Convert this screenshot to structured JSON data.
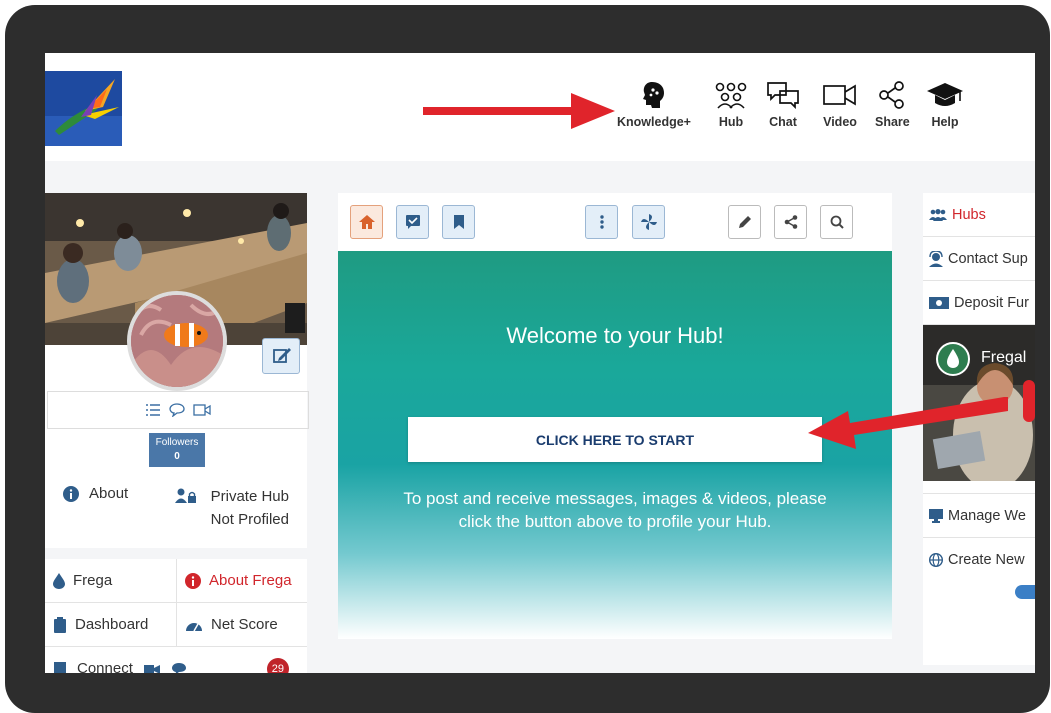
{
  "nav": {
    "items": [
      {
        "label": "Knowledge+",
        "icon": "brain-icon"
      },
      {
        "label": "Hub",
        "icon": "users-icon"
      },
      {
        "label": "Chat",
        "icon": "chat-icon"
      },
      {
        "label": "Video",
        "icon": "video-icon"
      },
      {
        "label": "Share",
        "icon": "share-icon"
      },
      {
        "label": "Help",
        "icon": "graduation-cap-icon"
      }
    ]
  },
  "profile": {
    "followers_label": "Followers",
    "followers_count": "0",
    "about_label": "About",
    "hub_type": "Private Hub",
    "hub_status": "Not Profiled"
  },
  "left_menu": [
    [
      "Frega",
      "About Frega"
    ],
    [
      "Dashboard",
      "Net Score"
    ],
    [
      "Connect",
      ""
    ]
  ],
  "left_menu_badge": "29",
  "hub": {
    "title": "Welcome to your Hub!",
    "start_button": "CLICK HERE TO START",
    "instructions": "To post and receive messages, images & videos, please click the button above to profile your Hub."
  },
  "right_menu": {
    "hubs": "Hubs",
    "contact": "Contact Sup",
    "deposit": "Deposit Fur",
    "video_title": "Fregal",
    "manage": "Manage We",
    "create": "Create New"
  },
  "colors": {
    "accent_red": "#e0242b",
    "hub_teal": "#1f9b82",
    "badge_red": "#c0232a",
    "followers_blue": "#4a77a8"
  }
}
